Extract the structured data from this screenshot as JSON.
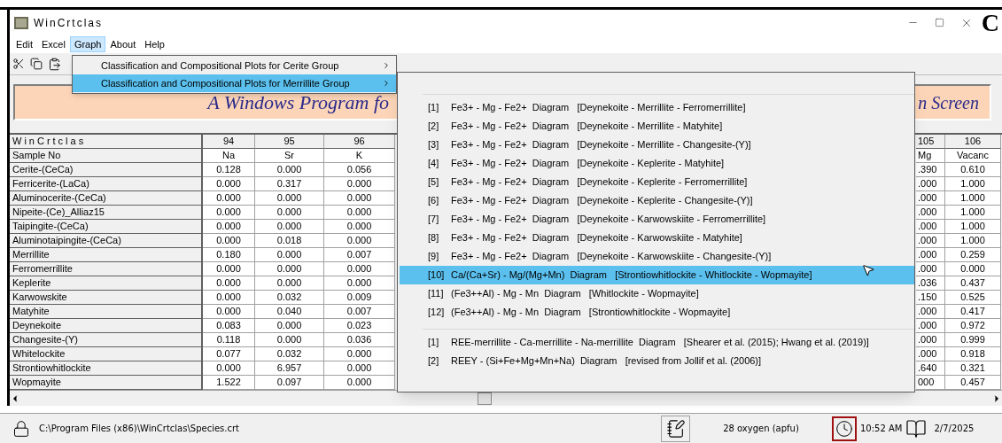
{
  "window": {
    "title": "WinCrtclas",
    "corner_text": "C"
  },
  "menu": [
    {
      "label": "Edit",
      "selected": false
    },
    {
      "label": "Excel",
      "selected": false
    },
    {
      "label": "Graph",
      "selected": true
    },
    {
      "label": "About",
      "selected": false
    },
    {
      "label": "Help",
      "selected": false
    }
  ],
  "graph_menu": [
    {
      "label": "Classification and Compositional Plots for Cerite Group",
      "selected": false
    },
    {
      "label": "Classification and Compositional Plots for Merrillite Group",
      "selected": true
    }
  ],
  "submenu": {
    "sections": [
      [
        {
          "number": "[1]",
          "text": "Fe3+ - Mg - Fe2+  Diagram   [Deynekoite - Merrillite - Ferromerrillite]",
          "selected": false
        },
        {
          "number": "[2]",
          "text": "Fe3+ - Mg - Fe2+  Diagram   [Deynekoite - Merrillite - Matyhite]",
          "selected": false
        },
        {
          "number": "[3]",
          "text": "Fe3+ - Mg - Fe2+  Diagram   [Deynekoite - Merrillite - Changesite-(Y)]",
          "selected": false
        },
        {
          "number": "[4]",
          "text": "Fe3+ - Mg - Fe2+  Diagram   [Deynekoite - Keplerite - Matyhite]",
          "selected": false
        },
        {
          "number": "[5]",
          "text": "Fe3+ - Mg - Fe2+  Diagram   [Deynekoite - Keplerite - Ferromerrillite]",
          "selected": false
        },
        {
          "number": "[6]",
          "text": "Fe3+ - Mg - Fe2+  Diagram   [Deynekoite - Keplerite - Changesite-(Y)]",
          "selected": false
        },
        {
          "number": "[7]",
          "text": "Fe3+ - Mg - Fe2+  Diagram   [Deynekoite - Karwowskiite - Ferromerrillite]",
          "selected": false
        },
        {
          "number": "[8]",
          "text": "Fe3+ - Mg - Fe2+  Diagram   [Deynekoite - Karwowskiite - Matyhite]",
          "selected": false
        },
        {
          "number": "[9]",
          "text": "Fe3+ - Mg - Fe2+  Diagram   [Deynekoite - Karwowskiite - Changesite-(Y)]",
          "selected": false
        },
        {
          "number": "[10]",
          "text": "Ca/(Ca+Sr) - Mg/(Mg+Mn)  Diagram   [Strontiowhitlockite - Whitlockite - Wopmayite]",
          "selected": true
        },
        {
          "number": "[11]",
          "text": "(Fe3++Al) - Mg - Mn  Diagram   [Whitlockite - Wopmayite]",
          "selected": false
        },
        {
          "number": "[12]",
          "text": "(Fe3++Al) - Mg - Mn  Diagram   [Strontiowhitlockite - Wopmayite]",
          "selected": false
        }
      ],
      [
        {
          "number": "[1]",
          "text": "REE-merrillite - Ca-merrillite - Na-merrillite  Diagram   [Shearer et al. (2015); Hwang et al. (2019)]",
          "selected": false
        },
        {
          "number": "[2]",
          "text": "REEY - (Si+Fe+Mg+Mn+Na)  Diagram   [revised from Jollif et al. (2006)]",
          "selected": false
        }
      ]
    ]
  },
  "banner": {
    "left_text": "A Windows Program fo",
    "right_text": "n Screen"
  },
  "table": {
    "corner": "WinCrtclas",
    "columns": [
      "94",
      "95",
      "96",
      "105",
      "106"
    ],
    "subheader": {
      "label": "Sample No",
      "values": [
        "Na",
        "Sr",
        "K",
        "Mg",
        "Vacanc"
      ]
    },
    "rows": [
      {
        "name": "Cerite-(CeCa)",
        "values": [
          "0.128",
          "0.000",
          "0.056",
          ".390",
          "0.610"
        ]
      },
      {
        "name": "Ferricerite-(LaCa)",
        "values": [
          "0.000",
          "0.317",
          "0.000",
          ".000",
          "1.000"
        ]
      },
      {
        "name": "Aluminocerite-(CeCa)",
        "values": [
          "0.000",
          "0.000",
          "0.000",
          ".000",
          "1.000"
        ]
      },
      {
        "name": "Nipeite-(Ce)_Alliaz15",
        "values": [
          "0.000",
          "0.000",
          "0.000",
          ".000",
          "1.000"
        ]
      },
      {
        "name": "Taipingite-(CeCa)",
        "values": [
          "0.000",
          "0.000",
          "0.000",
          ".000",
          "1.000"
        ]
      },
      {
        "name": "Aluminotaipingite-(CeCa)",
        "values": [
          "0.000",
          "0.018",
          "0.000",
          ".000",
          "1.000"
        ]
      },
      {
        "name": "Merrillite",
        "values": [
          "0.180",
          "0.000",
          "0.007",
          ".000",
          "0.259"
        ]
      },
      {
        "name": "Ferromerrillite",
        "values": [
          "0.000",
          "0.000",
          "0.000",
          ".000",
          "0.000"
        ]
      },
      {
        "name": "Keplerite",
        "values": [
          "0.000",
          "0.000",
          "0.000",
          ".036",
          "0.437"
        ]
      },
      {
        "name": "Karwowskite",
        "values": [
          "0.000",
          "0.032",
          "0.009",
          ".150",
          "0.525"
        ]
      },
      {
        "name": "Matyhite",
        "values": [
          "0.000",
          "0.040",
          "0.007",
          ".000",
          "0.417"
        ]
      },
      {
        "name": "Deynekoite",
        "values": [
          "0.083",
          "0.000",
          "0.023",
          ".000",
          "0.972"
        ]
      },
      {
        "name": "Changesite-(Y)",
        "values": [
          "0.118",
          "0.000",
          "0.036",
          ".000",
          "0.999"
        ]
      },
      {
        "name": "Whitelockite",
        "values": [
          "0.077",
          "0.032",
          "0.000",
          ".000",
          "0.918"
        ]
      },
      {
        "name": "Strontiowhitlockite",
        "values": [
          "0.000",
          "6.957",
          "0.000",
          ".640",
          "0.321"
        ]
      },
      {
        "name": "Wopmayite",
        "values": [
          "1.522",
          "0.097",
          "0.000",
          "000",
          "0.457"
        ]
      }
    ]
  },
  "status_bar": {
    "path": "C:\\Program Files (x86)\\WinCrtclas\\Species.crt",
    "basis": "28 oxygen (apfu)",
    "time": "10:52 AM",
    "date": "2/7/2025"
  }
}
